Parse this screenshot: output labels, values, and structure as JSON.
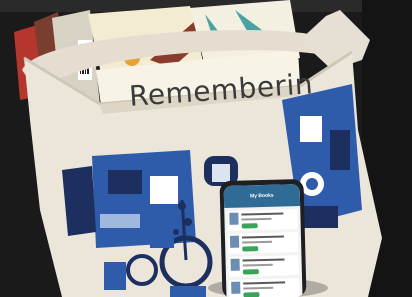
{
  "photo": {
    "book_title_text": "Rememberin",
    "phone_app_header": "My Books",
    "colors": {
      "bag_canvas": "#ece6da",
      "print_blue": "#2e5cab",
      "print_navy": "#1c2f5e",
      "background": "#1a1a1a",
      "phone_body": "#1d1f24",
      "app_header": "#2f6b94",
      "app_button": "#3aa35a"
    }
  }
}
